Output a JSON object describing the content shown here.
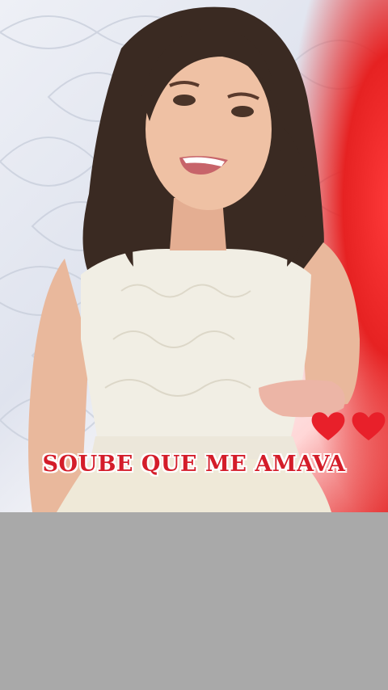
{
  "video": {
    "caption": "SOUBE QUE ME AMAVA",
    "overlay_icons": [
      "heart-icon",
      "heart-icon"
    ]
  },
  "colors": {
    "caption_text": "#d41d2a",
    "caption_outline": "#ffffff",
    "heart": "#e8202a",
    "stage_light": "#e62222",
    "bottom_panel": "#a9a9a9"
  }
}
